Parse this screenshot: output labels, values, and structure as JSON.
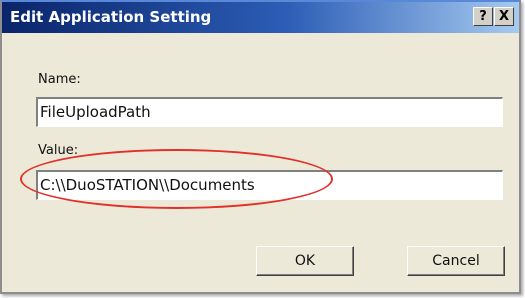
{
  "window": {
    "title": "Edit Application Setting",
    "help_glyph": "?",
    "close_glyph": "X"
  },
  "form": {
    "name_label": "Name:",
    "name_value": "FileUploadPath",
    "value_label": "Value:",
    "value_value": "C:\\\\DuoSTATION\\\\Documents"
  },
  "buttons": {
    "ok_label": "OK",
    "cancel_label": "Cancel"
  },
  "colors": {
    "titlebar_start": "#0a246a",
    "titlebar_end": "#a6caf0",
    "dialog_bg": "#ece9d8",
    "highlight_annotation": "#e0322a"
  }
}
